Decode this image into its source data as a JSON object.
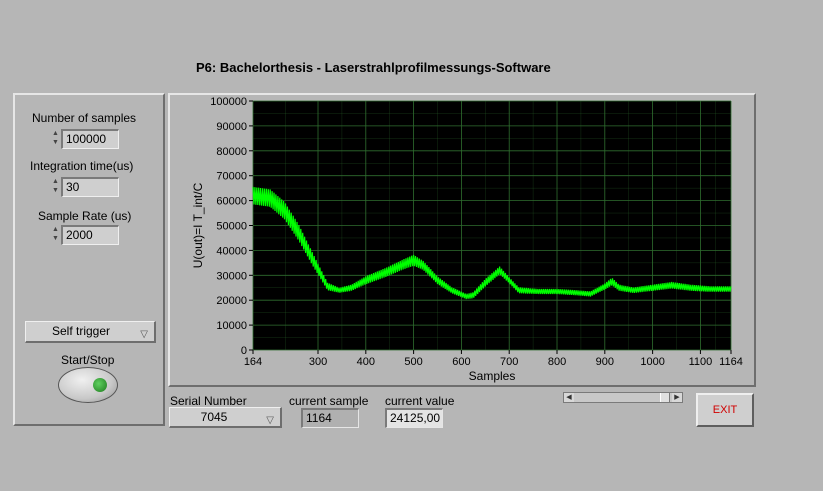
{
  "window": {
    "title": "P6: Bachelorthesis - Laserstrahlprofilmessungs-Software"
  },
  "controls": {
    "samples": {
      "label": "Number of samples",
      "value": "100000"
    },
    "integration": {
      "label": "Integration time(us)",
      "value": "30"
    },
    "rate": {
      "label": "Sample Rate (us)",
      "value": "2000"
    },
    "trigger": {
      "selected": "Self trigger"
    },
    "start": {
      "label": "Start/Stop"
    }
  },
  "bottom": {
    "serial": {
      "label": "Serial Number",
      "value": "7045"
    },
    "current_sample": {
      "label": "current sample",
      "value": "1164"
    },
    "current_value": {
      "label": "current value",
      "value": "24125,00"
    },
    "exit_label": "EXIT"
  },
  "icons": {
    "spin": "spin-arrows-icon",
    "ring_arrow": "chevron-down-icon",
    "scroll_left": "arrow-left-icon",
    "scroll_right": "arrow-right-icon"
  },
  "colors": {
    "plot_background": "#000000",
    "grid": "#2f6e2f",
    "trace": "#00ff00",
    "exit_text": "#d00000"
  },
  "chart_data": {
    "type": "line",
    "xlabel": "Samples",
    "ylabel": "U(out)=I T_int/C",
    "xlim": [
      164,
      1164
    ],
    "ylim": [
      0,
      100000
    ],
    "x_ticks": [
      164,
      300,
      400,
      500,
      600,
      700,
      800,
      900,
      1000,
      1100,
      1164
    ],
    "y_ticks": [
      0,
      10000,
      20000,
      30000,
      40000,
      50000,
      60000,
      70000,
      80000,
      90000,
      100000
    ],
    "y_tick_labels": [
      "0",
      "10000",
      "20000",
      "30000",
      "40000",
      "50000",
      "60000",
      "70000",
      "80000",
      "90000",
      "100000"
    ],
    "grid": true,
    "series": [
      {
        "x": [
          164,
          200,
          230,
          260,
          290,
          320,
          345,
          370,
          400,
          440,
          480,
          500,
          520,
          550,
          580,
          610,
          625,
          650,
          680,
          700,
          720,
          760,
          800,
          840,
          870,
          900,
          915,
          930,
          960,
          1000,
          1040,
          1080,
          1120,
          1164
        ],
        "y": [
          62000,
          61000,
          56000,
          47000,
          36000,
          25500,
          24000,
          25000,
          28000,
          31000,
          34500,
          36000,
          34000,
          28000,
          24000,
          21500,
          22000,
          27000,
          32000,
          28000,
          24000,
          23500,
          23500,
          23000,
          22500,
          25500,
          27500,
          25000,
          24000,
          25000,
          26000,
          25000,
          24500,
          24500
        ],
        "amplitude": [
          3500,
          3500,
          3500,
          3200,
          2500,
          1500,
          1000,
          1200,
          1600,
          1800,
          2000,
          2200,
          1800,
          1500,
          1200,
          1000,
          1200,
          1500,
          1500,
          1200,
          1200,
          1000,
          1000,
          1000,
          1000,
          1200,
          1500,
          1200,
          1100,
          1200,
          1300,
          1200,
          1100,
          1100
        ]
      }
    ]
  }
}
